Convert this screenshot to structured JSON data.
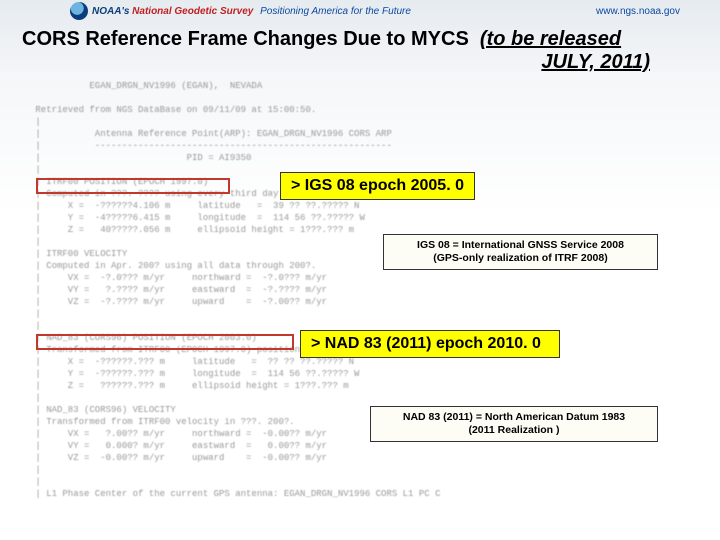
{
  "topbar": {
    "noaa": "NOAA's",
    "ngs": "National Geodetic Survey",
    "tagline": "Positioning America for the Future",
    "url": "www.ngs.noaa.gov"
  },
  "title": {
    "main": "CORS Reference Frame Changes Due to MYCS",
    "release": "(to be released",
    "release2": "JULY, 2011)"
  },
  "callouts": {
    "igs08": "> IGS 08 epoch 2005. 0",
    "nad83": "> NAD 83 (2011) epoch 2010. 0"
  },
  "notes": {
    "igs08_1": "IGS 08 = International GNSS Service 2008",
    "igs08_2": "(GPS-only realization of ITRF 2008)",
    "nad83_1": "NAD 83 (2011) = North American Datum 1983",
    "nad83_2": "(2011 Realization )"
  },
  "datasheet": {
    "prefix": " |",
    "lines": {
      "l0": "           EGAN_DRGN_NV1996 (EGAN),  NEVADA",
      "l1": "",
      "l2": " Retrieved from NGS DataBase on 09/11/09 at 15:00:50.",
      "l3": "",
      "l4": "          Antenna Reference Point(ARP): EGAN_DRGN_NV1996 CORS ARP",
      "l5": "          -------------------------------------------------------",
      "l6": "                           PID = AI9350",
      "l7": "",
      "l8": " ITRF00 POSITION (EPOCH 1997.0)",
      "l9": " Computed in ???. ???? using every third day of data through 200?.",
      "l10": "     X =  -??????4.106 m     latitude   =  39 ?? ??.????? N",
      "l11": "     Y =  -4?????6.415 m     longitude  =  114 56 ??.????? W",
      "l12": "     Z =   40?????.056 m     ellipsoid height = 1???.??? m",
      "l13": "",
      "l14": " ITRF00 VELOCITY",
      "l15": " Computed in Apr. 200? using all data through 200?.",
      "l16": "     VX =  -?.0??? m/yr     northward =  -?.0??? m/yr",
      "l17": "     VY =   ?.???? m/yr     eastward  =  -?.???? m/yr",
      "l18": "     VZ =  -?.???? m/yr     upward    =  -?.00?? m/yr",
      "l19": "",
      "l20": "",
      "l21": " NAD_83 (CORS96) POSITION (EPOCH 2003.0)",
      "l22": " Transformed from ITRF00 (EPOCH 1997.0) position in ???. 200?.",
      "l23": "     X =  -??????.??? m     latitude   =  ?? ?? ??.????? N",
      "l24": "     Y =  -??????.??? m     longitude  =  114 56 ??.????? W",
      "l25": "     Z =   ??????.??? m     ellipsoid height = 1???.??? m",
      "l26": "",
      "l27": " NAD_83 (CORS96) VELOCITY",
      "l28": " Transformed from ITRF00 velocity in ???. 200?.",
      "l29": "     VX =   ?.00?? m/yr     northward =  -0.00?? m/yr",
      "l30": "     VY =   0.000? m/yr     eastward  =   0.00?? m/yr",
      "l31": "     VZ =  -0.00?? m/yr     upward    =  -0.00?? m/yr",
      "l32": "",
      "l33": "",
      "l34": " L1 Phase Center of the current GPS antenna: EGAN_DRGN_NV1996 CORS L1 PC C"
    }
  }
}
